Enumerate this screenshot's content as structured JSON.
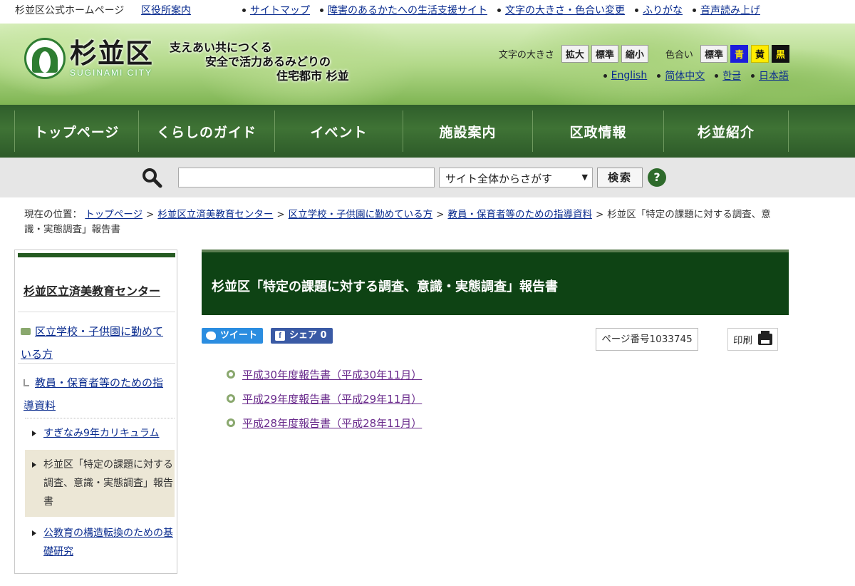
{
  "topbar": {
    "official": "杉並区公式ホームページ",
    "office_link": "区役所案内",
    "nav": [
      "サイトマップ",
      "障害のあるかたへの生活支援サイト",
      "文字の大きさ・色合い変更",
      "ふりがな",
      "音声読み上げ"
    ]
  },
  "header": {
    "logo_kanji": "杉並区",
    "logo_roman": "SUGINAMI CITY",
    "slogan": [
      "支えあい共につくる",
      "安全で活力あるみどりの",
      "住宅都市 杉並"
    ],
    "font_size_label": "文字の大きさ",
    "font_buttons": [
      "拡大",
      "標準",
      "縮小"
    ],
    "color_label": "色合い",
    "color_buttons": [
      "標準",
      "青",
      "黄",
      "黒"
    ],
    "languages": [
      "English",
      "简体中文",
      "한글",
      "日本語"
    ]
  },
  "mainnav": [
    "トップページ",
    "くらしのガイド",
    "イベント",
    "施設案内",
    "区政情報",
    "杉並紹介"
  ],
  "search": {
    "input_value": "",
    "scope": "サイト全体からさがす",
    "button": "検索",
    "help": "?"
  },
  "breadcrumb": {
    "label": "現在の位置：",
    "links": [
      "トップページ",
      "杉並区立済美教育センター",
      "区立学校・子供園に勤めている方",
      "教員・保育者等のための指導資料"
    ],
    "current": "杉並区「特定の課題に対する調査、意識・実態調査」報告書"
  },
  "sidebar": {
    "title": "杉並区立済美教育センター",
    "level1": "区立学校・子供園に勤めている方",
    "level2": "教員・保育者等のための指導資料",
    "subs": [
      {
        "label": "すぎなみ9年カリキュラム",
        "current": false
      },
      {
        "label": "杉並区「特定の課題に対する調査、意識・実態調査」報告書",
        "current": true
      },
      {
        "label": "公教育の構造転換のための基礎研究",
        "current": false
      }
    ]
  },
  "content": {
    "title": "杉並区「特定の課題に対する調査、意識・実態調査」報告書",
    "tweet": "ツイート",
    "share": "シェア 0",
    "page_number": "ページ番号1033745",
    "print": "印刷",
    "reports": [
      "平成30年度報告書（平成30年11月）",
      "平成29年度報告書（平成29年11月）",
      "平成28年度報告書（平成28年11月）"
    ]
  },
  "colors": {
    "header_green": "#2f5e2b",
    "title_bg": "#0e4314",
    "link_visited": "#6a2b8c",
    "tweet": "#2b8de0",
    "facebook": "#3a5aa5"
  }
}
